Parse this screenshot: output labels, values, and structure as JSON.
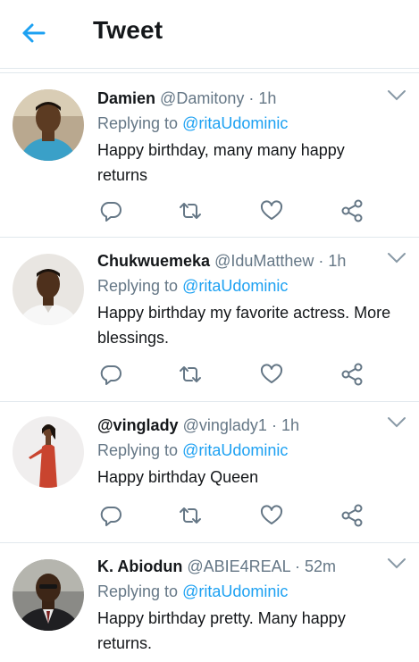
{
  "header": {
    "title": "Tweet",
    "back_icon": "arrow-left-icon"
  },
  "colors": {
    "accent": "#1da1f2",
    "text": "#14171a",
    "muted": "#657786",
    "divider": "#e1e8ed"
  },
  "tweets": [
    {
      "name": "Damien",
      "handle": "@Damitony",
      "separator": "·",
      "time": "1h",
      "replying_prefix": "Replying to",
      "replying_to": "@ritaUdominic",
      "text": "Happy birthday, many many happy returns"
    },
    {
      "name": "Chukwuemeka",
      "handle": "@IduMatthew",
      "separator": "·",
      "time": "1h",
      "replying_prefix": "Replying to",
      "replying_to": "@ritaUdominic",
      "text": "Happy birthday my favorite actress. More blessings."
    },
    {
      "name": "@vinglady",
      "handle": "@vinglady1",
      "separator": "·",
      "time": "1h",
      "replying_prefix": "Replying to",
      "replying_to": "@ritaUdominic",
      "text": "Happy birthday Queen"
    },
    {
      "name": "K. Abiodun",
      "handle": "@ABIE4REAL",
      "separator": "·",
      "time": "52m",
      "replying_prefix": "Replying to",
      "replying_to": "@ritaUdominic",
      "text": "Happy birthday pretty. Many happy returns."
    }
  ],
  "action_icons": [
    "reply-icon",
    "retweet-icon",
    "like-icon",
    "share-icon"
  ]
}
